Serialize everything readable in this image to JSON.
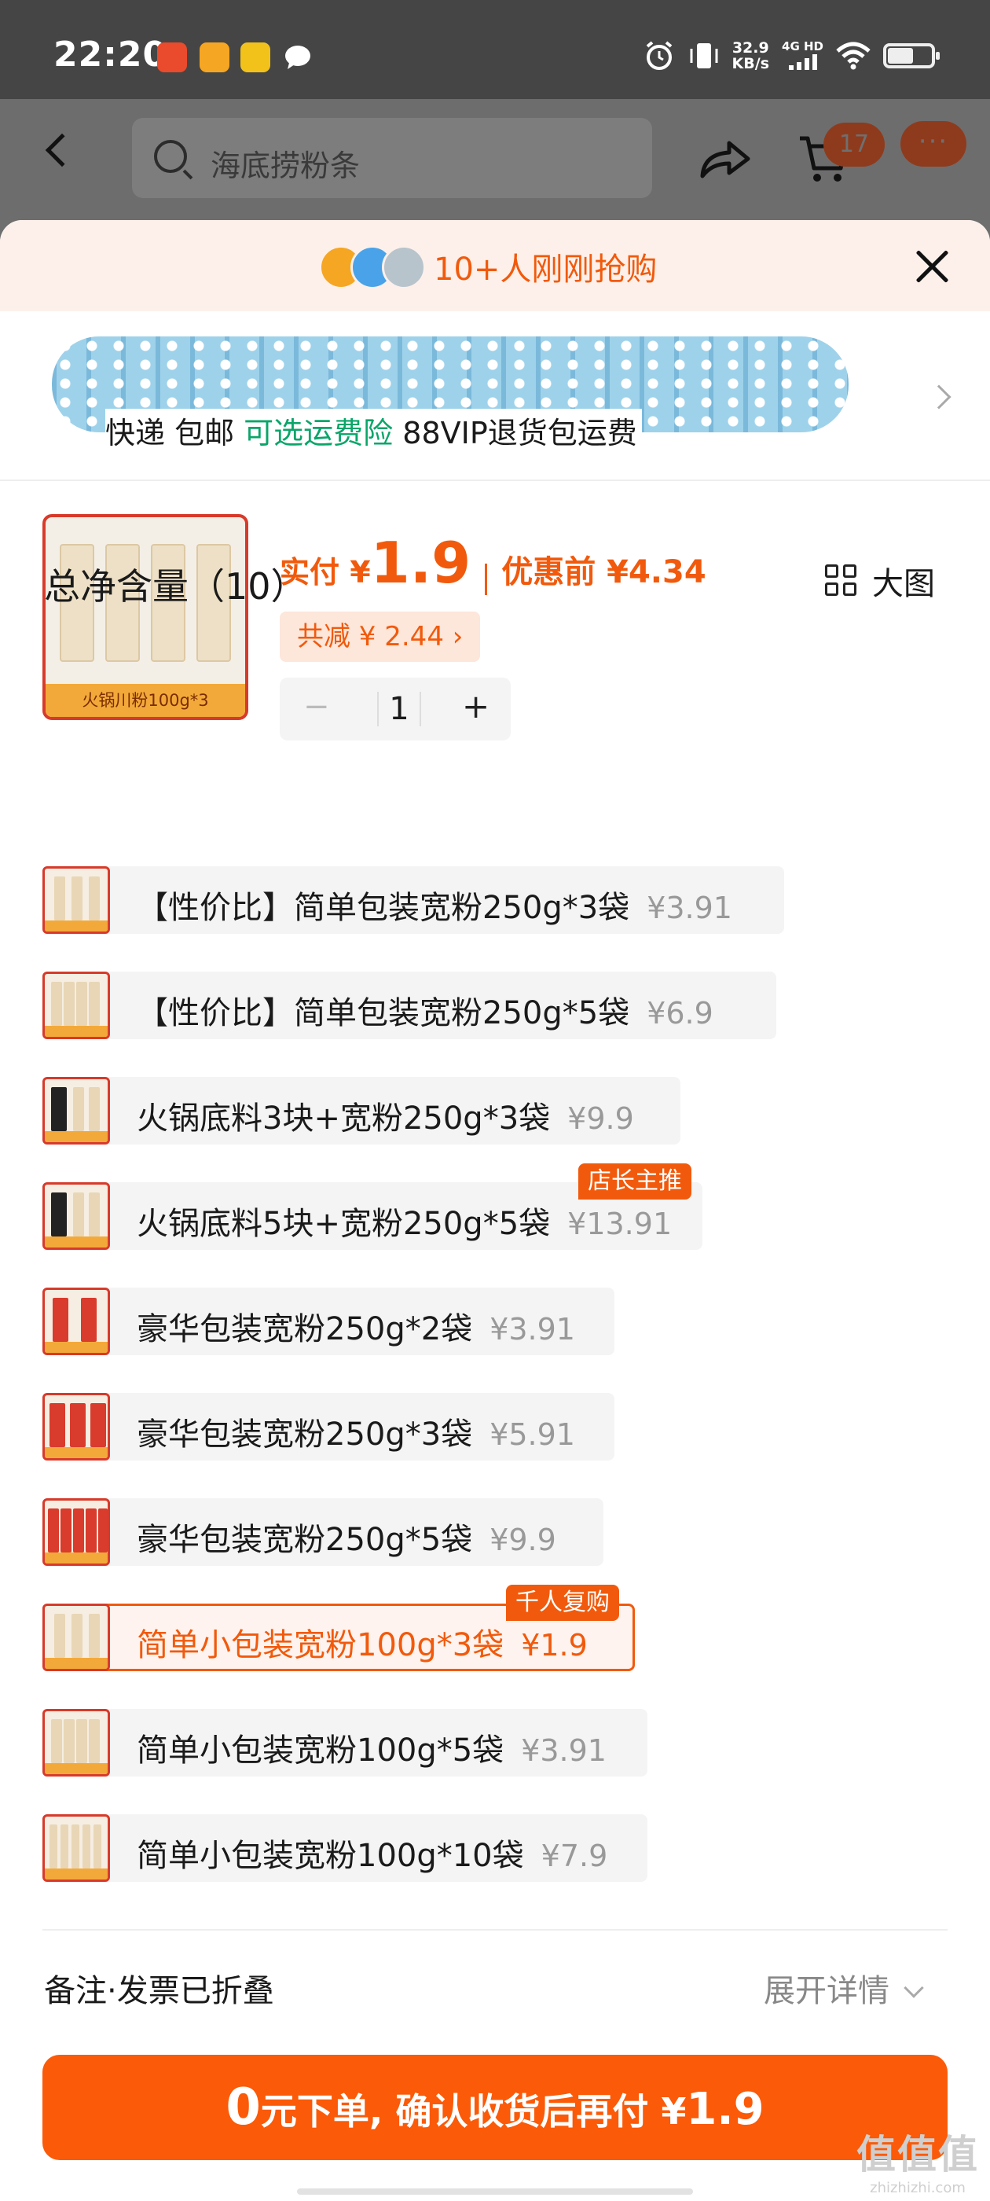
{
  "status_bar": {
    "time": "22:20",
    "net_speed": "32.9",
    "net_unit": "KB/s",
    "net_type": "4G HD"
  },
  "nav": {
    "search_placeholder": "海底捞粉条",
    "cart_count": "17",
    "more": "···"
  },
  "banner": {
    "text": "10+人刚刚抢购"
  },
  "address": {
    "ship_prefix": "快递 包邮 ",
    "insurance": "可选运费险",
    "ship_suffix": " 88VIP退货包运费"
  },
  "product": {
    "thumb_label": "火锅川粉100g*3",
    "pay_label": "实付 ¥",
    "pay_value": "1.9",
    "pre_label": "优惠前 ¥4.34",
    "discount": "共减 ¥ 2.44 ›",
    "qty_minus": "−",
    "qty": "1",
    "qty_plus": "+"
  },
  "section": {
    "title": "总净含量（10）",
    "view_toggle": "大图"
  },
  "options": [
    {
      "name": "【性价比】简单包装宽粉250g*3袋",
      "price": "¥3.91"
    },
    {
      "name": "【性价比】简单包装宽粉250g*5袋",
      "price": "¥6.9"
    },
    {
      "name": "火锅底料3块+宽粉250g*3袋",
      "price": "¥9.9"
    },
    {
      "name": "火锅底料5块+宽粉250g*5袋",
      "price": "¥13.91",
      "tag": "店长主推"
    },
    {
      "name": "豪华包装宽粉250g*2袋",
      "price": "¥3.91"
    },
    {
      "name": "豪华包装宽粉250g*3袋",
      "price": "¥5.91"
    },
    {
      "name": "豪华包装宽粉250g*5袋",
      "price": "¥9.9"
    },
    {
      "name": "简单小包装宽粉100g*3袋",
      "price": "¥1.9",
      "tag": "千人复购",
      "selected": true
    },
    {
      "name": "简单小包装宽粉100g*5袋",
      "price": "¥3.91"
    },
    {
      "name": "简单小包装宽粉100g*10袋",
      "price": "¥7.9"
    }
  ],
  "footer": {
    "notes": "备注·发票已折叠",
    "expand": "展开详情",
    "cta_zero": "0",
    "cta_text": "元下单, 确认收货后再付 ¥",
    "cta_amount": "1.9"
  },
  "watermark": {
    "main": "值值值",
    "sub": "zhizhizhi.com"
  },
  "colors": {
    "accent": "#f15a0c",
    "cta": "#fb5a08",
    "insurance_green": "#0aa56a",
    "thumb_border": "#d83a2a"
  }
}
